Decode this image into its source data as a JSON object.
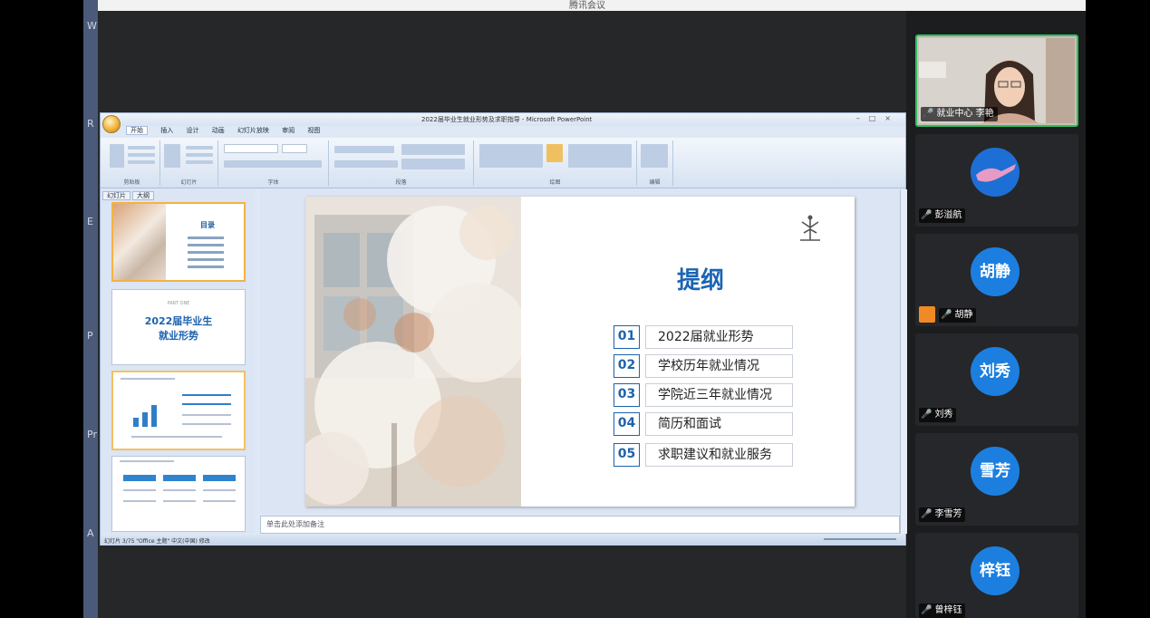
{
  "meeting": {
    "window_title": "腾讯会议"
  },
  "leftbar": {
    "letters": [
      "W",
      "R",
      "E",
      "P",
      "Pr",
      "A"
    ]
  },
  "ppt": {
    "caption": "2022届毕业生就业形势及求职指导 - Microsoft PowerPoint",
    "tabs": [
      "开始",
      "插入",
      "设计",
      "动画",
      "幻灯片放映",
      "审阅",
      "视图"
    ],
    "ribbon_groups": [
      "剪贴板",
      "幻灯片",
      "字体",
      "段落",
      "绘图",
      "编辑"
    ],
    "panel_tabs": [
      "幻灯片",
      "大纲"
    ],
    "thumbs": {
      "t1_title": "目录",
      "t2_title_line1": "2022届毕业生",
      "t2_title_line2": "就业形势",
      "t2_small": "PART ONE"
    },
    "notes_placeholder": "单击此处添加备注",
    "status_left": "幻灯片 3/75   \"Office 主题\"   中文(中国)   修改"
  },
  "slide": {
    "title": "提纲",
    "items": [
      {
        "num": "01",
        "text": "2022届就业形势"
      },
      {
        "num": "02",
        "text": "学校历年就业情况"
      },
      {
        "num": "03",
        "text": "学院近三年就业情况"
      },
      {
        "num": "04",
        "text": "简历和面试"
      },
      {
        "num": "05",
        "text": "求职建议和就业服务"
      }
    ]
  },
  "participants": [
    {
      "name": "就业中心 李艳",
      "type": "video",
      "mic": "on"
    },
    {
      "name": "彭溢航",
      "type": "image",
      "mic": "off"
    },
    {
      "name": "胡静",
      "avatar": "胡静",
      "mic": "on",
      "host": true
    },
    {
      "name": "刘秀",
      "avatar": "刘秀",
      "mic": "off"
    },
    {
      "name": "李雪芳",
      "avatar": "雪芳",
      "mic": "off"
    },
    {
      "name": "曾梓钰",
      "avatar": "梓钰",
      "mic": "off"
    }
  ],
  "colors": {
    "accent": "#1c64b2",
    "avatar": "#1c7fe0",
    "active_border": "#2fbf5c"
  }
}
